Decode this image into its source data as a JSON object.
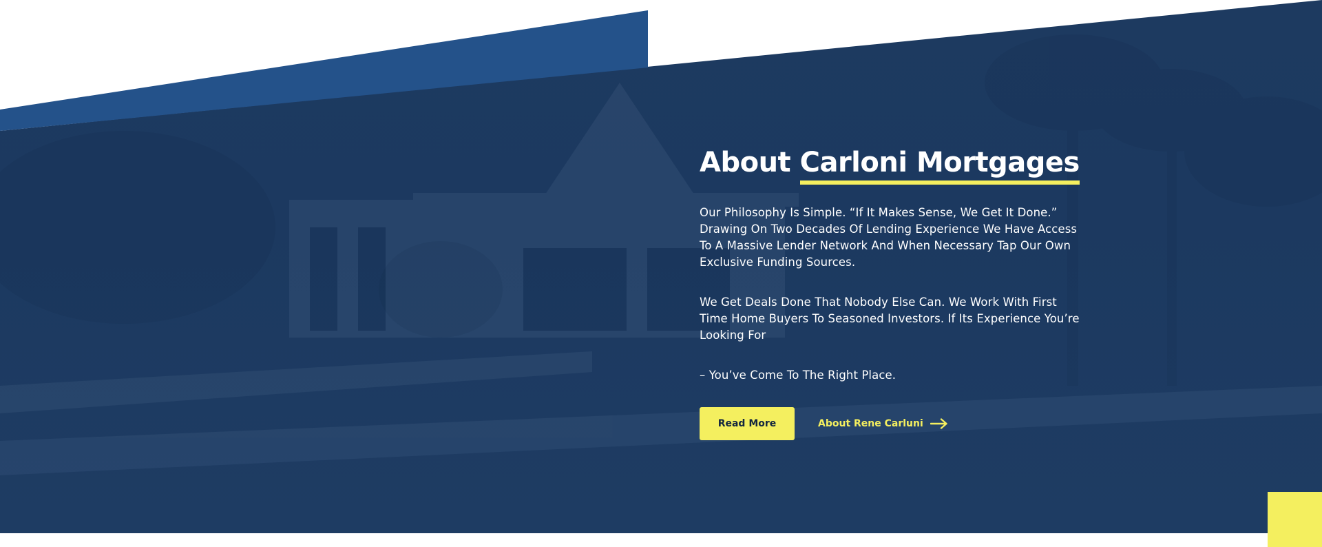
{
  "section": {
    "title_prefix": "About",
    "title_highlight": "Carloni Mortgages",
    "paragraphs": [
      "Our Philosophy Is Simple. “If It Makes Sense, We Get It Done.” Drawing On Two Decades Of Lending Experience We Have Access To A Massive Lender Network And When Necessary Tap Our Own Exclusive Funding Sources.",
      "We Get Deals Done That Nobody Else Can. We Work With First Time Home Buyers To Seasoned Investors.  If Its Experience You’re Looking For",
      "– You’ve Come To The Right Place."
    ],
    "primary_button": "Read More",
    "secondary_link": "About Rene Carluni"
  },
  "icons": {
    "secondary_link_icon": "arrow-right-icon"
  },
  "colors": {
    "overlay_navy": "#1d3a60",
    "accent_blue": "#24528a",
    "accent_yellow": "#f4ef5f",
    "text_white": "#ffffff"
  }
}
